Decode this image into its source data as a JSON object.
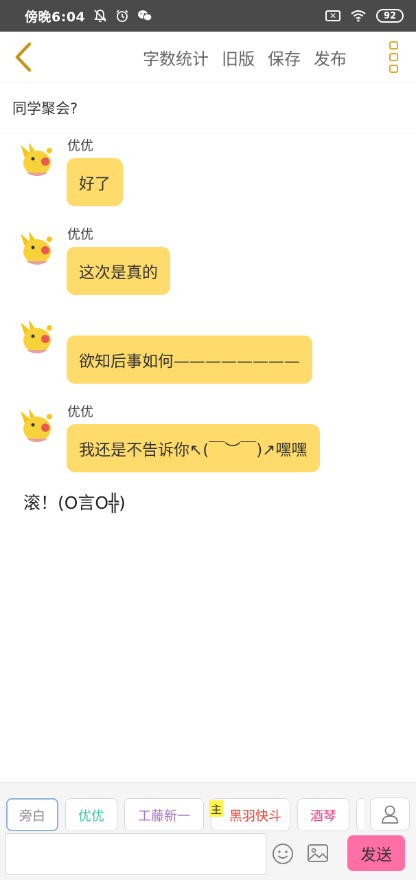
{
  "status_bar": {
    "time": "傍晚6:04",
    "battery": "92",
    "icons": [
      "bell-off-icon",
      "alarm-icon",
      "wechat-icon",
      "sim-x-icon",
      "wifi-icon",
      "battery-icon"
    ]
  },
  "toolbar": {
    "actions": [
      "字数统计",
      "旧版",
      "保存",
      "发布"
    ],
    "accent_color": "#d4aa2c"
  },
  "story": {
    "title": "同学聚会?"
  },
  "messages": [
    {
      "sender": "优优",
      "text": "好了"
    },
    {
      "sender": "优优",
      "text": "这次是真的"
    },
    {
      "sender": "",
      "text": "欲知后事如何————————"
    },
    {
      "sender": "优优",
      "text": "我还是不告诉你↖(￣︶￣)↗嘿嘿"
    }
  ],
  "narration": "滚！(O言O╬)",
  "roles": [
    {
      "label": "旁白",
      "color": "#8a8a8a",
      "active": true
    },
    {
      "label": "优优",
      "color": "#3cbfb0",
      "active": false
    },
    {
      "label": "工藤新一",
      "color": "#a672c8",
      "active": false
    },
    {
      "label": "黑羽快斗",
      "color": "#e0453a",
      "active": false,
      "tag": "主"
    },
    {
      "label": "酒琴",
      "color": "#e0468a",
      "active": false
    }
  ],
  "composer": {
    "input_value": "",
    "placeholder": "",
    "send_label": "发送",
    "send_color": "#ff6ea4"
  },
  "bubble_color": "#ffdb6b"
}
